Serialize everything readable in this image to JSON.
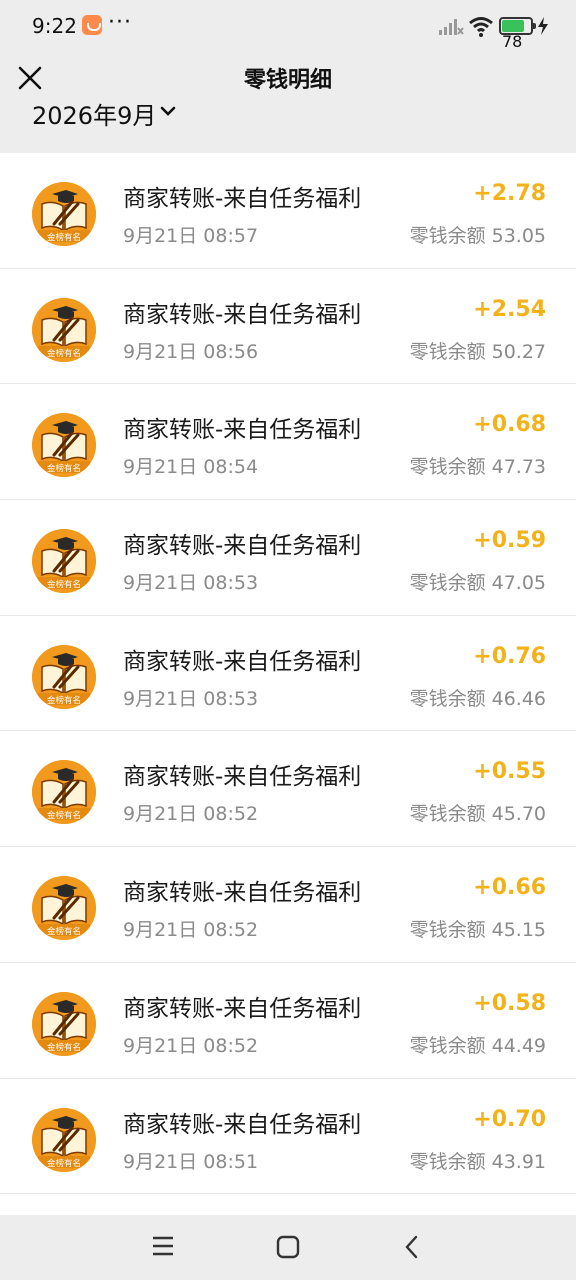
{
  "status_bar": {
    "time": "9:22",
    "battery_level": "78",
    "battery_fraction": 0.78
  },
  "header": {
    "title": "零钱明细"
  },
  "month_filter": {
    "label": "2026年9月"
  },
  "colors": {
    "amount": "#f3b21a",
    "avatar_bg": "#f29a1d"
  },
  "avatar_text": "金榜有名",
  "transactions": [
    {
      "title": "商家转账-来自任务福利",
      "time": "9月21日 08:57",
      "amount": "+2.78",
      "balance": "零钱余额 53.05"
    },
    {
      "title": "商家转账-来自任务福利",
      "time": "9月21日 08:56",
      "amount": "+2.54",
      "balance": "零钱余额 50.27"
    },
    {
      "title": "商家转账-来自任务福利",
      "time": "9月21日 08:54",
      "amount": "+0.68",
      "balance": "零钱余额 47.73"
    },
    {
      "title": "商家转账-来自任务福利",
      "time": "9月21日 08:53",
      "amount": "+0.59",
      "balance": "零钱余额 47.05"
    },
    {
      "title": "商家转账-来自任务福利",
      "time": "9月21日 08:53",
      "amount": "+0.76",
      "balance": "零钱余额 46.46"
    },
    {
      "title": "商家转账-来自任务福利",
      "time": "9月21日 08:52",
      "amount": "+0.55",
      "balance": "零钱余额 45.70"
    },
    {
      "title": "商家转账-来自任务福利",
      "time": "9月21日 08:52",
      "amount": "+0.66",
      "balance": "零钱余额 45.15"
    },
    {
      "title": "商家转账-来自任务福利",
      "time": "9月21日 08:52",
      "amount": "+0.58",
      "balance": "零钱余额 44.49"
    },
    {
      "title": "商家转账-来自任务福利",
      "time": "9月21日 08:51",
      "amount": "+0.70",
      "balance": "零钱余额 43.91"
    }
  ],
  "icons": {
    "close": "close-icon",
    "chevron": "chevron-down-icon",
    "menu": "menu-icon",
    "home": "home-icon",
    "back": "back-icon"
  }
}
